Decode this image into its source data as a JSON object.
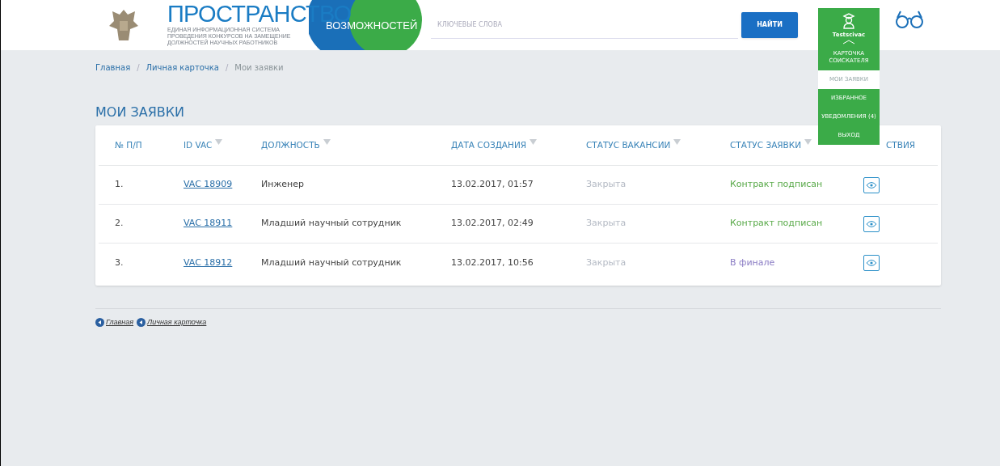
{
  "header": {
    "logo_title": "ПРОСТРАНСТВО",
    "logo_subtitle": "ВОЗМОЖНОСТЕЙ",
    "logo_caption": [
      "ЕДИНАЯ ИНФОРМАЦИОННАЯ СИСТЕМА",
      "ПРОВЕДЕНИЯ КОНКУРСОВ НА ЗАМЕЩЕНИЕ",
      "ДОЛЖНОСТЕЙ НАУЧНЫХ РАБОТНИКОВ"
    ],
    "search": {
      "placeholder": "КЛЮЧЕВЫЕ СЛОВА"
    },
    "search_button": "НАЙТИ"
  },
  "user_menu": {
    "username": "Testscivac",
    "expanded": true,
    "items": [
      {
        "label": "КАРТОЧКА СОИСКАТЕЛЯ",
        "selected": false
      },
      {
        "label": "МОИ ЗАЯВКИ",
        "selected": true
      },
      {
        "label": "ИЗБРАННОЕ",
        "selected": false
      },
      {
        "label": "УВЕДОМЛЕНИЯ (4)",
        "selected": false
      },
      {
        "label": "ВЫХОД",
        "selected": false
      }
    ]
  },
  "breadcrumb_separator": "/",
  "breadcrumbs": [
    {
      "label": "Главная",
      "current": false
    },
    {
      "label": "Личная карточка",
      "current": false
    },
    {
      "label": "Мои заявки",
      "current": true
    }
  ],
  "page_title": "МОИ ЗАЯВКИ",
  "table": {
    "columns": [
      {
        "label": "№ П/П",
        "sortable": false
      },
      {
        "label": "ID VAC",
        "sortable": true
      },
      {
        "label": "ДОЛЖНОСТЬ",
        "sortable": true
      },
      {
        "label": "ДАТА СОЗДАНИЯ",
        "sortable": true
      },
      {
        "label": "СТАТУС ВАКАНСИИ",
        "sortable": true
      },
      {
        "label": "СТАТУС ЗАЯВКИ",
        "sortable": true
      },
      {
        "label": "СТВИЯ",
        "sortable": false
      }
    ],
    "rows": [
      {
        "num": "1.",
        "id": "VAC 18909",
        "position": "Инженер",
        "date": "13.02.2017, 01:57",
        "vacancy_status": "Закрыта",
        "status": "Контракт подписан",
        "color": "#5aaa4a"
      },
      {
        "num": "2.",
        "id": "VAC 18911",
        "position": "Младший научный сотрудник",
        "date": "13.02.2017, 02:49",
        "vacancy_status": "Закрыта",
        "status": "Контракт подписан",
        "color": "#5aaa4a"
      },
      {
        "num": "3.",
        "id": "VAC 18912",
        "position": "Младший научный сотрудник",
        "date": "13.02.2017, 10:56",
        "vacancy_status": "Закрыта",
        "status": "В финале",
        "color": "#8a7cc4"
      }
    ]
  },
  "footer_links": [
    "Главная",
    "Личная карточка"
  ]
}
